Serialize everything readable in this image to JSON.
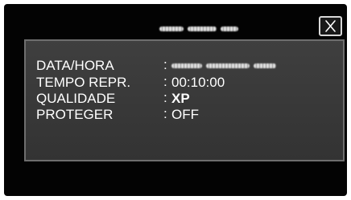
{
  "header": {
    "title_obscured": true,
    "close_icon": "close-icon"
  },
  "info": {
    "rows": [
      {
        "label": "DATA/HORA",
        "separator": ":",
        "value": "",
        "value_obscured": true
      },
      {
        "label": "TEMPO REPR.",
        "separator": ":",
        "value": "00:10:00"
      },
      {
        "label": "QUALIDADE",
        "separator": ":",
        "value": "XP"
      },
      {
        "label": "PROTEGER",
        "separator": ":",
        "value": "OFF"
      }
    ]
  },
  "colors": {
    "screen_background": "#030303",
    "panel_background": "#3a3a3a",
    "panel_border": "#6e6e6e",
    "text": "#ffffff"
  }
}
